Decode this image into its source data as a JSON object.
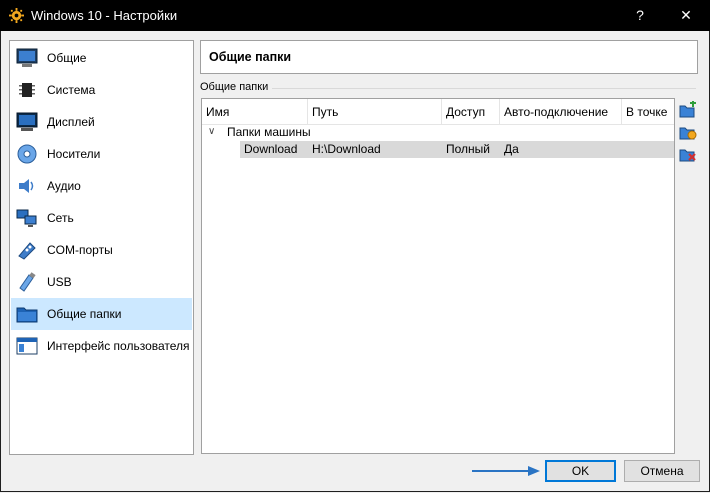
{
  "window": {
    "title": "Windows 10 - Настройки",
    "help_glyph": "?",
    "close_glyph": "✕"
  },
  "sidebar": {
    "items": [
      {
        "label": "Общие",
        "icon": "general-icon"
      },
      {
        "label": "Система",
        "icon": "system-chip-icon"
      },
      {
        "label": "Дисплей",
        "icon": "display-monitor-icon"
      },
      {
        "label": "Носители",
        "icon": "storage-disc-icon"
      },
      {
        "label": "Аудио",
        "icon": "audio-speaker-icon"
      },
      {
        "label": "Сеть",
        "icon": "network-icon"
      },
      {
        "label": "COM-порты",
        "icon": "serial-port-icon"
      },
      {
        "label": "USB",
        "icon": "usb-icon"
      },
      {
        "label": "Общие папки",
        "icon": "shared-folder-icon",
        "selected": true
      },
      {
        "label": "Интерфейс пользователя",
        "icon": "user-interface-icon"
      }
    ]
  },
  "main": {
    "page_title": "Общие папки",
    "group_label": "Общие папки",
    "table": {
      "columns": [
        "Имя",
        "Путь",
        "Доступ",
        "Авто-подключение",
        "В точке"
      ],
      "groups": [
        {
          "name": "Папки машины",
          "expanded": true,
          "rows": [
            {
              "name": "Download",
              "path": "H:\\Download",
              "access": "Полный",
              "auto_mount": "Да",
              "mount_point": ""
            }
          ]
        }
      ]
    },
    "side_tools": [
      "add-folder-icon",
      "edit-folder-icon",
      "remove-folder-icon"
    ]
  },
  "footer": {
    "ok_label": "OK",
    "cancel_label": "Отмена"
  },
  "colors": {
    "selection": "#cce8ff",
    "accent": "#0078d7",
    "arrow": "#2a74c4",
    "row_highlight": "#d9d9d9"
  }
}
